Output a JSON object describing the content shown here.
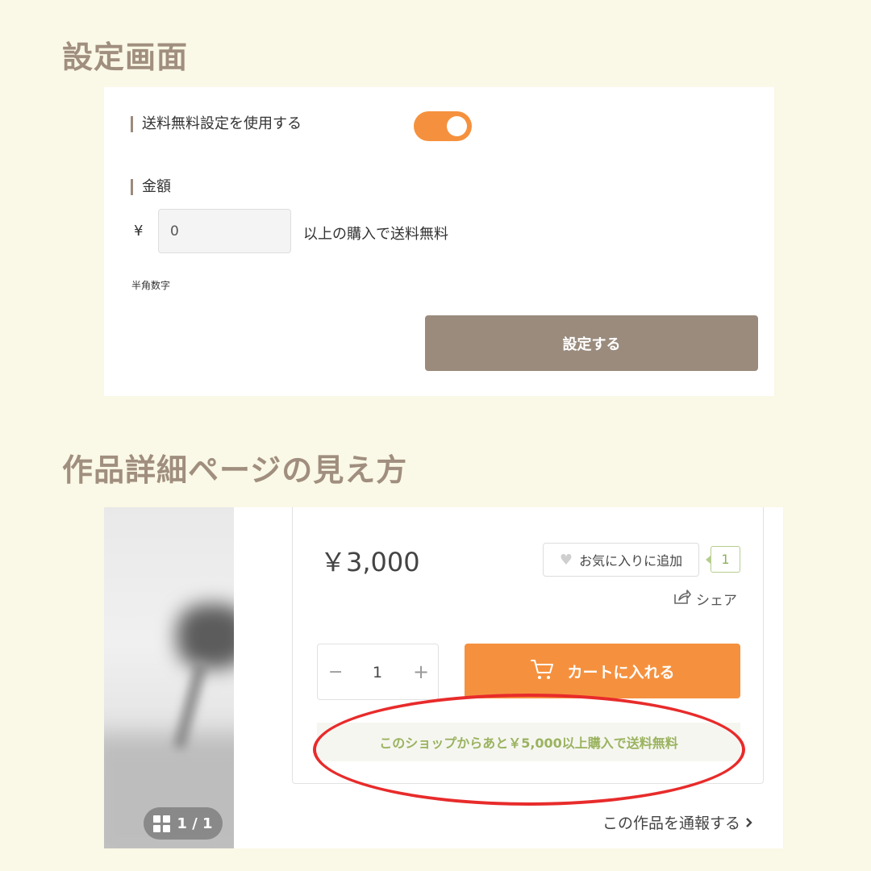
{
  "headings": {
    "settings": "設定画面",
    "preview": "作品詳細ページの見え方"
  },
  "settings": {
    "free_shipping_label": "送料無料設定を使用する",
    "free_shipping_enabled": true,
    "amount_label": "金額",
    "currency_symbol": "¥",
    "amount_value": "0",
    "amount_suffix": "以上の購入で送料無料",
    "hint": "半角数字",
    "submit_label": "設定する"
  },
  "product": {
    "image_counter": "1 / 1",
    "price": "￥3,000",
    "favorite_label": "お気に入りに追加",
    "favorite_count": "1",
    "share_label": "シェア",
    "quantity": "1",
    "minus_symbol": "−",
    "plus_symbol": "+",
    "cart_label": "カートに入れる",
    "free_shipping_message": "このショップからあと￥5,000以上購入で送料無料",
    "report_link": "この作品を通報する"
  },
  "colors": {
    "background": "#faf8e6",
    "heading": "#a08e7e",
    "accent_orange": "#f5913e",
    "button_brown": "#9a8b7d",
    "highlight_red": "#e82b2b",
    "message_green": "#9ab35f"
  },
  "icons": [
    "heart-icon",
    "share-icon",
    "cart-icon",
    "grid-icon",
    "chevron-right-icon"
  ]
}
